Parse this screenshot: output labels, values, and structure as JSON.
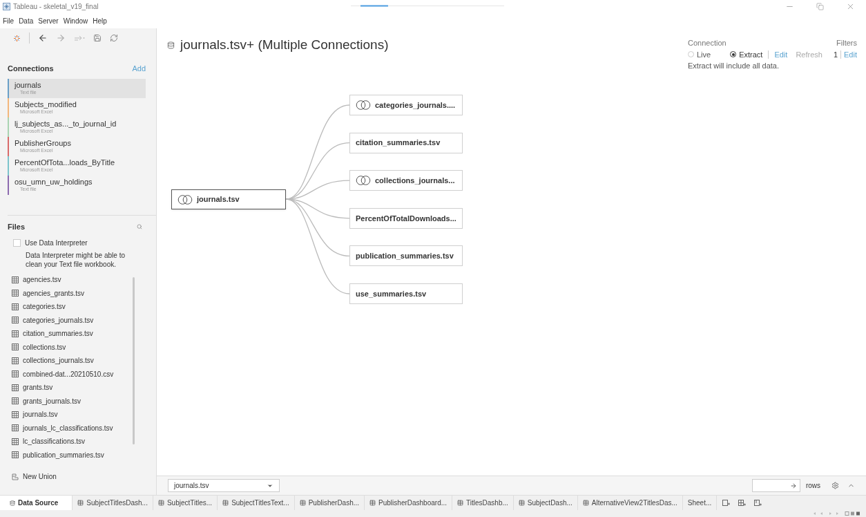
{
  "window": {
    "title": "Tableau - skeletal_v19_final"
  },
  "progress": {
    "level": 0.18
  },
  "menu": [
    "File",
    "Data",
    "Server",
    "Window",
    "Help"
  ],
  "connections": {
    "title": "Connections",
    "add": "Add",
    "items": [
      {
        "name": "journals",
        "type": "Text file",
        "color": "#6a9fc8",
        "selected": true
      },
      {
        "name": "Subjects_modified",
        "type": "Microsoft Excel",
        "color": "#f3b77c",
        "selected": false
      },
      {
        "name": "lj_subjects_as..._to_journal_id",
        "type": "Microsoft Excel",
        "color": "#a9d4b2",
        "selected": false
      },
      {
        "name": "PublisherGroups",
        "type": "Microsoft Excel",
        "color": "#d96a6a",
        "selected": false
      },
      {
        "name": "PercentOfTota...loads_ByTitle",
        "type": "Microsoft Excel",
        "color": "#7cc4cc",
        "selected": false
      },
      {
        "name": "osu_umn_uw_holdings",
        "type": "Text file",
        "color": "#8c6ab0",
        "selected": false
      }
    ]
  },
  "files": {
    "title": "Files",
    "interpreter": {
      "label": "Use Data Interpreter",
      "checked": false,
      "hint": "Data Interpreter might be able to clean your Text file workbook."
    },
    "items": [
      "agencies.tsv",
      "agencies_grants.tsv",
      "categories.tsv",
      "categories_journals.tsv",
      "citation_summaries.tsv",
      "collections.tsv",
      "collections_journals.tsv",
      "combined-dat...20210510.csv",
      "grants.tsv",
      "grants_journals.tsv",
      "journals.tsv",
      "journals_lc_classifications.tsv",
      "lc_classifications.tsv",
      "publication_summaries.tsv"
    ],
    "new_union": "New Union"
  },
  "datasource": {
    "title": "journals.tsv+ (Multiple Connections)",
    "connection": {
      "label": "Connection",
      "live": "Live",
      "extract": "Extract",
      "mode_extract": true,
      "edit": "Edit",
      "refresh": "Refresh",
      "note": "Extract will include all data."
    },
    "filters": {
      "label": "Filters",
      "count": "1",
      "edit": "Edit"
    }
  },
  "canvas": {
    "root": {
      "name": "journals.tsv",
      "union": true
    },
    "joins": [
      {
        "name": "categories_journals....",
        "union": true
      },
      {
        "name": "citation_summaries.tsv",
        "union": false
      },
      {
        "name": "collections_journals...",
        "union": true
      },
      {
        "name": "PercentOfTotalDownloads...",
        "union": false
      },
      {
        "name": "publication_summaries.tsv",
        "union": false
      },
      {
        "name": "use_summaries.tsv",
        "union": false
      }
    ]
  },
  "preview": {
    "table": "journals.tsv",
    "rows": "rows"
  },
  "sheet_tabs": [
    {
      "label": "Data Source",
      "kind": "source",
      "selected": true
    },
    {
      "label": "SubjectTitlesDash...",
      "kind": "dashboard",
      "selected": false
    },
    {
      "label": "SubjectTitles...",
      "kind": "dashboard",
      "selected": false
    },
    {
      "label": "SubjectTitlesText...",
      "kind": "dashboard",
      "selected": false
    },
    {
      "label": "PublisherDash...",
      "kind": "dashboard",
      "selected": false
    },
    {
      "label": "PublisherDashboard...",
      "kind": "dashboard",
      "selected": false
    },
    {
      "label": "TitlesDashb...",
      "kind": "dashboard",
      "selected": false
    },
    {
      "label": "SubjectDash...",
      "kind": "dashboard",
      "selected": false
    },
    {
      "label": "AlternativeView2TitlesDas...",
      "kind": "dashboard",
      "selected": false
    },
    {
      "label": "Sheet...",
      "kind": "sheet",
      "selected": false
    }
  ]
}
